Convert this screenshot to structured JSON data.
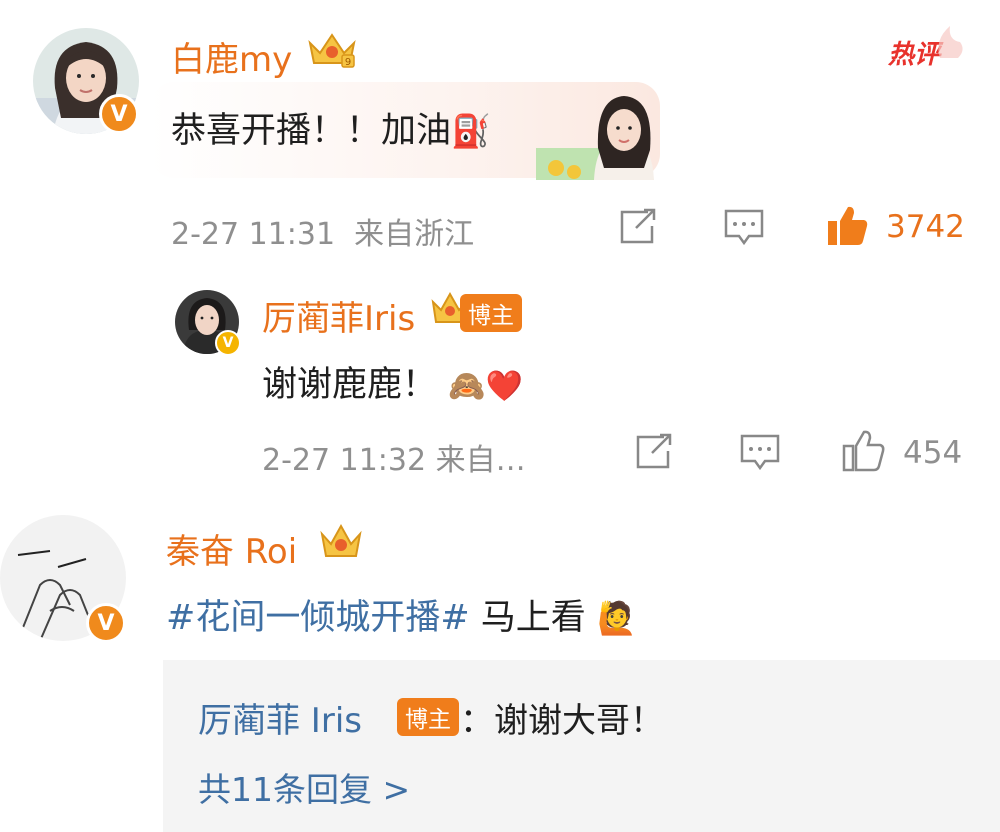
{
  "hot_label": "热评",
  "comments": [
    {
      "username": "白鹿my",
      "text": "恭喜开播！！加油",
      "text_emoji": "⛽",
      "time": "2-27 11:31",
      "location": "来自浙江",
      "likes": "3742",
      "liked": true,
      "reply": {
        "username": "厉蔺菲Iris",
        "badge": "博主",
        "text": "谢谢鹿鹿！",
        "emoji": "🙈❤️",
        "time": "2-27 11:32",
        "location": "来自…",
        "likes": "454"
      }
    },
    {
      "username": "秦奋 Roi",
      "hashtag": "#花间一倾城开播#",
      "text": "马上看",
      "emoji": "🙋",
      "subreply": {
        "username": "厉蔺菲 Iris",
        "badge": "博主",
        "separator": "：",
        "text": "谢谢大哥！"
      },
      "more_replies": "共11条回复 >"
    }
  ],
  "colors": {
    "accent": "#e8711c",
    "link": "#3f6fa3",
    "like_active": "#f07d1b",
    "meta": "#8f8f8f"
  }
}
